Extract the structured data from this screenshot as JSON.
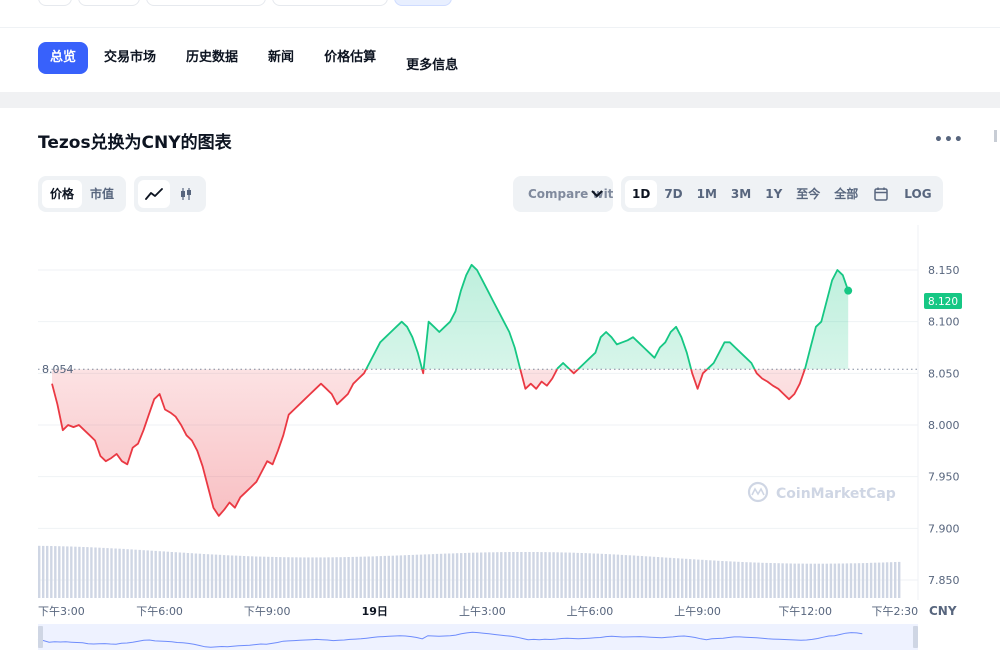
{
  "tabs": {
    "overview": "总览",
    "markets": "交易市场",
    "history": "历史数据",
    "news": "新闻",
    "estimate": "价格估算",
    "more": "更多信息"
  },
  "chart_title": "Tezos兑换为CNY的图表",
  "more_menu": "•••",
  "toggles": {
    "price": "价格",
    "market_cap": "市值"
  },
  "compare_label": "Compare with",
  "ranges": {
    "d1": "1D",
    "d7": "7D",
    "m1": "1M",
    "m3": "3M",
    "y1": "1Y",
    "ytd": "至今",
    "all": "全部",
    "log": "LOG"
  },
  "icons": {
    "line_chart": "line-chart-icon",
    "candle_chart": "candlestick-icon",
    "calendar": "calendar-icon",
    "chevron": "chevron-down-icon",
    "watermark": "coinmarketcap-logo"
  },
  "watermark_text": "CoinMarketCap",
  "colors": {
    "accent": "#3861fb",
    "up": "#16c784",
    "down": "#ea3943",
    "grid": "#eff2f5",
    "volume": "#cfd6e4"
  },
  "chart_data": {
    "type": "line",
    "baseline": 8.054,
    "baseline_label": "8.054",
    "current_label": "8.120",
    "ylim": [
      7.825,
      8.175
    ],
    "y_ticks": [
      "8.150",
      "8.100",
      "8.050",
      "8.000",
      "7.950",
      "7.900",
      "7.850"
    ],
    "y_tick_values": [
      8.15,
      8.1,
      8.05,
      8.0,
      7.95,
      7.9,
      7.85
    ],
    "x_ticks": [
      "下午3:00",
      "下午6:00",
      "下午9:00",
      "19日",
      "上午3:00",
      "上午6:00",
      "上午9:00",
      "下午12:00",
      "下午2:30"
    ],
    "x_tick_hours": [
      0,
      3,
      6,
      9,
      12,
      15,
      18,
      21,
      23.5
    ],
    "currency": "CNY",
    "x_hours": [
      0,
      0.15,
      0.3,
      0.45,
      0.6,
      0.75,
      0.9,
      1.05,
      1.2,
      1.35,
      1.5,
      1.65,
      1.8,
      1.95,
      2.1,
      2.25,
      2.4,
      2.55,
      2.7,
      2.85,
      3.0,
      3.15,
      3.3,
      3.45,
      3.6,
      3.75,
      3.9,
      4.05,
      4.2,
      4.35,
      4.5,
      4.65,
      4.8,
      4.95,
      5.1,
      5.25,
      5.4,
      5.55,
      5.7,
      5.85,
      6.0,
      6.15,
      6.3,
      6.45,
      6.6,
      6.75,
      6.9,
      7.05,
      7.2,
      7.35,
      7.5,
      7.65,
      7.8,
      7.95,
      8.1,
      8.25,
      8.4,
      8.55,
      8.7,
      8.85,
      9.0,
      9.15,
      9.3,
      9.45,
      9.6,
      9.75,
      9.9,
      10.05,
      10.2,
      10.35,
      10.5,
      10.65,
      10.8,
      10.95,
      11.1,
      11.25,
      11.4,
      11.55,
      11.7,
      11.85,
      12.0,
      12.15,
      12.3,
      12.45,
      12.6,
      12.75,
      12.9,
      13.05,
      13.2,
      13.35,
      13.5,
      13.65,
      13.8,
      13.95,
      14.1,
      14.25,
      14.4,
      14.55,
      14.7,
      14.85,
      15.0,
      15.15,
      15.3,
      15.45,
      15.6,
      15.75,
      15.9,
      16.05,
      16.2,
      16.35,
      16.5,
      16.65,
      16.8,
      16.95,
      17.1,
      17.25,
      17.4,
      17.55,
      17.7,
      17.85,
      18.0,
      18.15,
      18.3,
      18.45,
      18.6,
      18.75,
      18.9,
      19.05,
      19.2,
      19.35,
      19.5,
      19.65,
      19.8,
      19.95,
      20.1,
      20.25,
      20.4,
      20.55,
      20.7,
      20.85,
      21.0,
      21.15,
      21.3,
      21.45,
      21.6,
      21.75,
      21.9,
      22.05,
      22.2,
      22.35,
      22.5,
      22.65,
      22.8,
      22.95,
      23.1,
      23.25,
      23.4,
      23.55,
      23.7
    ],
    "values": [
      8.04,
      8.02,
      7.995,
      8.0,
      7.998,
      8.0,
      7.995,
      7.99,
      7.985,
      7.97,
      7.965,
      7.968,
      7.972,
      7.965,
      7.962,
      7.978,
      7.982,
      7.995,
      8.01,
      8.025,
      8.03,
      8.015,
      8.012,
      8.008,
      8.0,
      7.99,
      7.985,
      7.975,
      7.96,
      7.94,
      7.92,
      7.912,
      7.918,
      7.925,
      7.92,
      7.93,
      7.935,
      7.94,
      7.945,
      7.955,
      7.965,
      7.962,
      7.975,
      7.99,
      8.01,
      8.015,
      8.02,
      8.025,
      8.03,
      8.035,
      8.04,
      8.035,
      8.03,
      8.02,
      8.025,
      8.03,
      8.04,
      8.045,
      8.05,
      8.06,
      8.07,
      8.08,
      8.085,
      8.09,
      8.095,
      8.1,
      8.095,
      8.085,
      8.07,
      8.05,
      8.1,
      8.095,
      8.09,
      8.095,
      8.1,
      8.11,
      8.13,
      8.145,
      8.155,
      8.15,
      8.14,
      8.13,
      8.12,
      8.11,
      8.1,
      8.09,
      8.075,
      8.055,
      8.035,
      8.04,
      8.035,
      8.042,
      8.038,
      8.045,
      8.055,
      8.06,
      8.055,
      8.05,
      8.055,
      8.06,
      8.065,
      8.07,
      8.085,
      8.09,
      8.085,
      8.078,
      8.08,
      8.082,
      8.085,
      8.08,
      8.075,
      8.07,
      8.065,
      8.075,
      8.08,
      8.09,
      8.095,
      8.085,
      8.07,
      8.05,
      8.035,
      8.05,
      8.055,
      8.06,
      8.07,
      8.08,
      8.08,
      8.075,
      8.07,
      8.065,
      8.06,
      8.05,
      8.045,
      8.042,
      8.038,
      8.035,
      8.03,
      8.025,
      8.03,
      8.04,
      8.055,
      8.075,
      8.095,
      8.1,
      8.12,
      8.14,
      8.15,
      8.145,
      8.13
    ],
    "volume_level": 0.9
  }
}
